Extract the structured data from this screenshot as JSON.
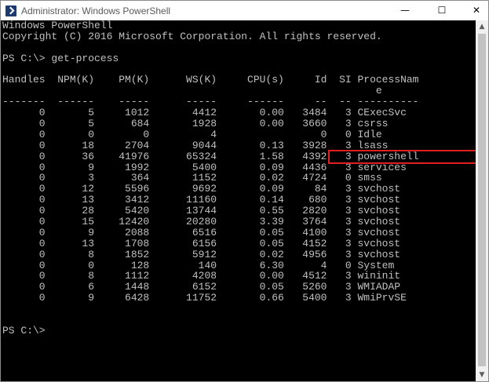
{
  "window": {
    "title": "Administrator: Windows PowerShell",
    "min_glyph": "—",
    "max_glyph": "☐",
    "close_glyph": "✕"
  },
  "console": {
    "banner_line1": "Windows PowerShell",
    "banner_line2": "Copyright (C) 2016 Microsoft Corporation. All rights reserved.",
    "prompt1": "PS C:\\> get-process",
    "header_line1": "Handles  NPM(K)    PM(K)      WS(K)     CPU(s)     Id  SI ProcessNam",
    "header_line2": "                                                             e",
    "separator": "-------  ------    -----      -----     ------     --  -- ----------",
    "rows": [
      {
        "handles": "0",
        "npm": "5",
        "pm": "1012",
        "ws": "4412",
        "cpu": "0.00",
        "id": "3484",
        "si": "3",
        "name": "CExecSvc"
      },
      {
        "handles": "0",
        "npm": "5",
        "pm": "684",
        "ws": "1928",
        "cpu": "0.00",
        "id": "3660",
        "si": "3",
        "name": "csrss"
      },
      {
        "handles": "0",
        "npm": "0",
        "pm": "0",
        "ws": "4",
        "cpu": "",
        "id": "0",
        "si": "0",
        "name": "Idle"
      },
      {
        "handles": "0",
        "npm": "18",
        "pm": "2704",
        "ws": "9044",
        "cpu": "0.13",
        "id": "3928",
        "si": "3",
        "name": "lsass"
      },
      {
        "handles": "0",
        "npm": "36",
        "pm": "41976",
        "ws": "65324",
        "cpu": "1.58",
        "id": "4392",
        "si": "3",
        "name": "powershell"
      },
      {
        "handles": "0",
        "npm": "9",
        "pm": "1992",
        "ws": "5400",
        "cpu": "0.09",
        "id": "4436",
        "si": "3",
        "name": "services"
      },
      {
        "handles": "0",
        "npm": "3",
        "pm": "364",
        "ws": "1152",
        "cpu": "0.02",
        "id": "4724",
        "si": "0",
        "name": "smss"
      },
      {
        "handles": "0",
        "npm": "12",
        "pm": "5596",
        "ws": "9692",
        "cpu": "0.09",
        "id": "84",
        "si": "3",
        "name": "svchost"
      },
      {
        "handles": "0",
        "npm": "13",
        "pm": "3412",
        "ws": "11160",
        "cpu": "0.14",
        "id": "680",
        "si": "3",
        "name": "svchost"
      },
      {
        "handles": "0",
        "npm": "28",
        "pm": "5420",
        "ws": "13744",
        "cpu": "0.55",
        "id": "2820",
        "si": "3",
        "name": "svchost"
      },
      {
        "handles": "0",
        "npm": "15",
        "pm": "12420",
        "ws": "20280",
        "cpu": "3.39",
        "id": "3764",
        "si": "3",
        "name": "svchost"
      },
      {
        "handles": "0",
        "npm": "9",
        "pm": "2088",
        "ws": "6516",
        "cpu": "0.05",
        "id": "4100",
        "si": "3",
        "name": "svchost"
      },
      {
        "handles": "0",
        "npm": "13",
        "pm": "1708",
        "ws": "6156",
        "cpu": "0.05",
        "id": "4152",
        "si": "3",
        "name": "svchost"
      },
      {
        "handles": "0",
        "npm": "8",
        "pm": "1852",
        "ws": "5912",
        "cpu": "0.02",
        "id": "4956",
        "si": "3",
        "name": "svchost"
      },
      {
        "handles": "0",
        "npm": "0",
        "pm": "128",
        "ws": "140",
        "cpu": "6.30",
        "id": "4",
        "si": "0",
        "name": "System"
      },
      {
        "handles": "0",
        "npm": "8",
        "pm": "1112",
        "ws": "4208",
        "cpu": "0.00",
        "id": "4512",
        "si": "3",
        "name": "wininit"
      },
      {
        "handles": "0",
        "npm": "6",
        "pm": "1448",
        "ws": "6152",
        "cpu": "0.05",
        "id": "5260",
        "si": "3",
        "name": "WMIADAP"
      },
      {
        "handles": "0",
        "npm": "9",
        "pm": "6428",
        "ws": "11752",
        "cpu": "0.66",
        "id": "5400",
        "si": "3",
        "name": "WmiPrvSE"
      }
    ],
    "prompt2": "PS C:\\>",
    "highlight_color": "#e02020"
  },
  "scrollbar": {
    "up_glyph": "▲",
    "down_glyph": "▼"
  },
  "colors": {
    "console_bg": "#000000",
    "console_fg": "#c0c0c0"
  }
}
